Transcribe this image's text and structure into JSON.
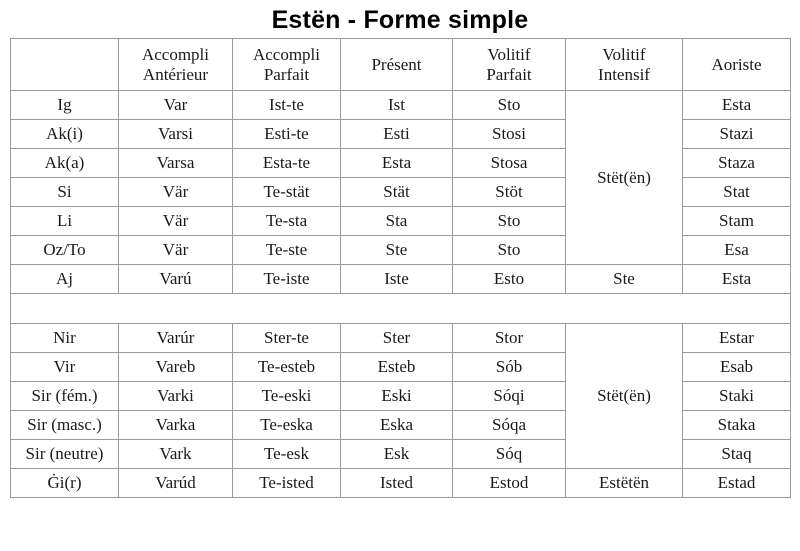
{
  "page": {
    "title": "Estën - Forme simple",
    "border_color": "#9a9a9a",
    "text_color": "#1a1a1a"
  },
  "table": {
    "columns": [
      {
        "id": "pronoun",
        "line1": "",
        "line2": ""
      },
      {
        "id": "accompli-anterieur",
        "line1": "Accompli",
        "line2": "Antérieur"
      },
      {
        "id": "accompli-parfait",
        "line1": "Accompli",
        "line2": "Parfait"
      },
      {
        "id": "present",
        "line1": "Présent",
        "line2": ""
      },
      {
        "id": "volitif-parfait",
        "line1": "Volitif",
        "line2": "Parfait"
      },
      {
        "id": "volitif-intensif",
        "line1": "Volitif",
        "line2": "Intensif"
      },
      {
        "id": "aoriste",
        "line1": "Aoriste",
        "line2": ""
      }
    ],
    "blocks": [
      {
        "id": "block-singular",
        "volitif_intensif_merged": "Stët(ën)",
        "volitif_intensif_merged_span": 6,
        "rows": [
          {
            "pronoun": "Ig",
            "accompli_anterieur": "Var",
            "accompli_parfait": "Ist-te",
            "present": "Ist",
            "volitif_parfait": "Sto",
            "aoriste": "Esta"
          },
          {
            "pronoun": "Ak(i)",
            "accompli_anterieur": "Varsi",
            "accompli_parfait": "Esti-te",
            "present": "Esti",
            "volitif_parfait": "Stosi",
            "aoriste": "Stazi"
          },
          {
            "pronoun": "Ak(a)",
            "accompli_anterieur": "Varsa",
            "accompli_parfait": "Esta-te",
            "present": "Esta",
            "volitif_parfait": "Stosa",
            "aoriste": "Staza"
          },
          {
            "pronoun": "Si",
            "accompli_anterieur": "Vär",
            "accompli_parfait": "Te-stät",
            "present": "Stät",
            "volitif_parfait": "Stöt",
            "aoriste": "Stat"
          },
          {
            "pronoun": "Li",
            "accompli_anterieur": "Vär",
            "accompli_parfait": "Te-sta",
            "present": "Sta",
            "volitif_parfait": "Sto",
            "aoriste": "Stam"
          },
          {
            "pronoun": "Oz/To",
            "accompli_anterieur": "Vär",
            "accompli_parfait": "Te-ste",
            "present": "Ste",
            "volitif_parfait": "Sto",
            "aoriste": "Esa"
          },
          {
            "pronoun": "Aj",
            "accompli_anterieur": "Varú",
            "accompli_parfait": "Te-iste",
            "present": "Iste",
            "volitif_parfait": "Esto",
            "volitif_intensif": "Ste",
            "aoriste": "Esta"
          }
        ]
      },
      {
        "id": "block-plural",
        "volitif_intensif_merged": "Stët(ën)",
        "volitif_intensif_merged_span": 5,
        "rows": [
          {
            "pronoun": "Nir",
            "accompli_anterieur": "Varúr",
            "accompli_parfait": "Ster-te",
            "present": "Ster",
            "volitif_parfait": "Stor",
            "aoriste": "Estar"
          },
          {
            "pronoun": "Vir",
            "accompli_anterieur": "Vareb",
            "accompli_parfait": "Te-esteb",
            "present": "Esteb",
            "volitif_parfait": "Sób",
            "aoriste": "Esab"
          },
          {
            "pronoun": "Sir (fém.)",
            "accompli_anterieur": "Varki",
            "accompli_parfait": "Te-eski",
            "present": "Eski",
            "volitif_parfait": "Sóqi",
            "aoriste": "Staki"
          },
          {
            "pronoun": "Sir (masc.)",
            "accompli_anterieur": "Varka",
            "accompli_parfait": "Te-eska",
            "present": "Eska",
            "volitif_parfait": "Sóqa",
            "aoriste": "Staka"
          },
          {
            "pronoun": "Sir (neutre)",
            "accompli_anterieur": "Vark",
            "accompli_parfait": "Te-esk",
            "present": "Esk",
            "volitif_parfait": "Sóq",
            "aoriste": "Staq"
          },
          {
            "pronoun": "Ġi(r)",
            "accompli_anterieur": "Varúd",
            "accompli_parfait": "Te-isted",
            "present": "Isted",
            "volitif_parfait": "Estod",
            "volitif_intensif": "Estëtën",
            "aoriste": "Estad"
          }
        ]
      }
    ]
  }
}
